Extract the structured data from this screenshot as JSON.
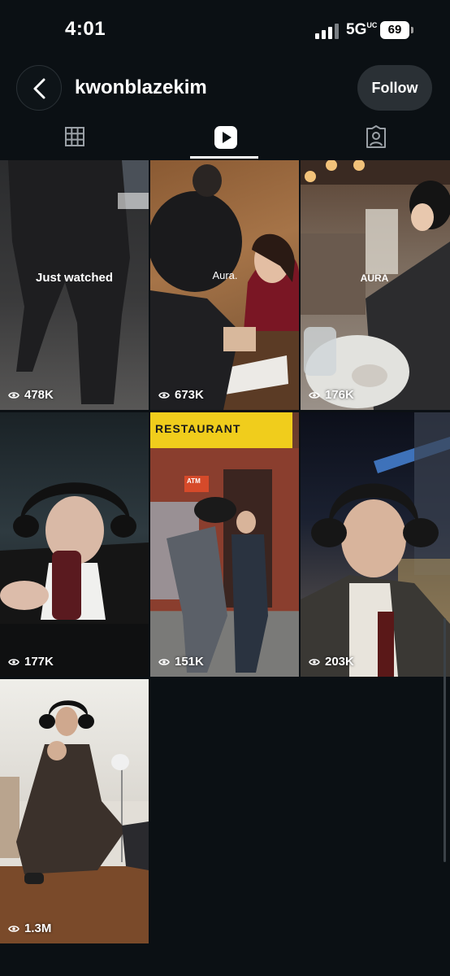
{
  "status": {
    "time": "4:01",
    "network": "5G",
    "network_sub": "UC",
    "battery": "69"
  },
  "header": {
    "username": "kwonblazekim",
    "follow_label": "Follow"
  },
  "tabs": [
    {
      "name": "grid",
      "icon": "grid-icon"
    },
    {
      "name": "reels",
      "icon": "reels-play-icon",
      "active": true
    },
    {
      "name": "tagged",
      "icon": "tagged-person-icon"
    }
  ],
  "reels": [
    {
      "views": "478K",
      "overlay": "Just watched"
    },
    {
      "views": "673K",
      "overlay": "Aura."
    },
    {
      "views": "176K",
      "overlay": "AURA"
    },
    {
      "views": "177K"
    },
    {
      "views": "151K",
      "sign": "RESTAURANT",
      "atm": "ATM"
    },
    {
      "views": "203K"
    },
    {
      "views": "1.3M"
    }
  ]
}
